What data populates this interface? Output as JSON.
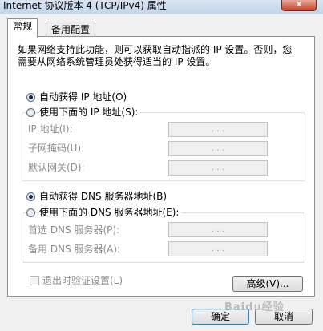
{
  "window": {
    "title": "Internet 协议版本 4 (TCP/IPv4) 属性",
    "close_label": "x"
  },
  "tabs": [
    {
      "label": "常规",
      "active": true
    },
    {
      "label": "备用配置",
      "active": false
    }
  ],
  "intro_text": "如果网络支持此功能，则可以获取自动指派的 IP 设置。否则，您需要从网络系统管理员处获得适当的 IP 设置。",
  "ip": {
    "auto_label": "自动获得 IP 地址(O)",
    "manual_label": "使用下面的 IP 地址(S):",
    "selected": "auto",
    "fields": [
      {
        "label": "IP 地址(I):",
        "value": ". . ."
      },
      {
        "label": "子网掩码(U):",
        "value": ". . ."
      },
      {
        "label": "默认网关(D):",
        "value": ". . ."
      }
    ]
  },
  "dns": {
    "auto_label": "自动获得 DNS 服务器地址(B)",
    "manual_label": "使用下面的 DNS 服务器地址(E):",
    "selected": "auto",
    "fields": [
      {
        "label": "首选 DNS 服务器(P):",
        "value": ". . ."
      },
      {
        "label": "备用 DNS 服务器(A):",
        "value": ". . ."
      }
    ]
  },
  "validate_on_exit": {
    "label": "退出时验证设置(L)",
    "checked": false,
    "enabled": false
  },
  "buttons": {
    "advanced": "高级(V)...",
    "ok": "确定",
    "cancel": "取消"
  },
  "watermark": "Baidu经验"
}
